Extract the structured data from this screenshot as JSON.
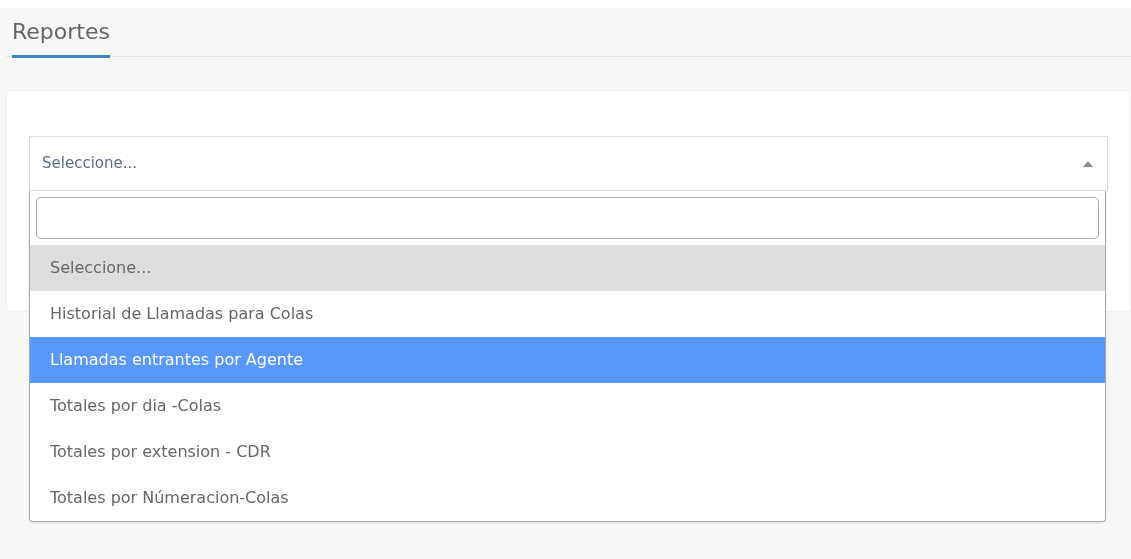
{
  "page": {
    "title": "Reportes"
  },
  "select": {
    "value": "Seleccione...",
    "expanded": true,
    "options": [
      {
        "label": "Seleccione...",
        "selected": true,
        "highlighted": false
      },
      {
        "label": "Historial de Llamadas para Colas",
        "selected": false,
        "highlighted": false
      },
      {
        "label": "Llamadas entrantes por Agente",
        "selected": false,
        "highlighted": true
      },
      {
        "label": "Totales por dia -Colas",
        "selected": false,
        "highlighted": false
      },
      {
        "label": "Totales por extension - CDR",
        "selected": false,
        "highlighted": false
      },
      {
        "label": "Totales por Númeracion-Colas",
        "selected": false,
        "highlighted": false
      }
    ]
  }
}
